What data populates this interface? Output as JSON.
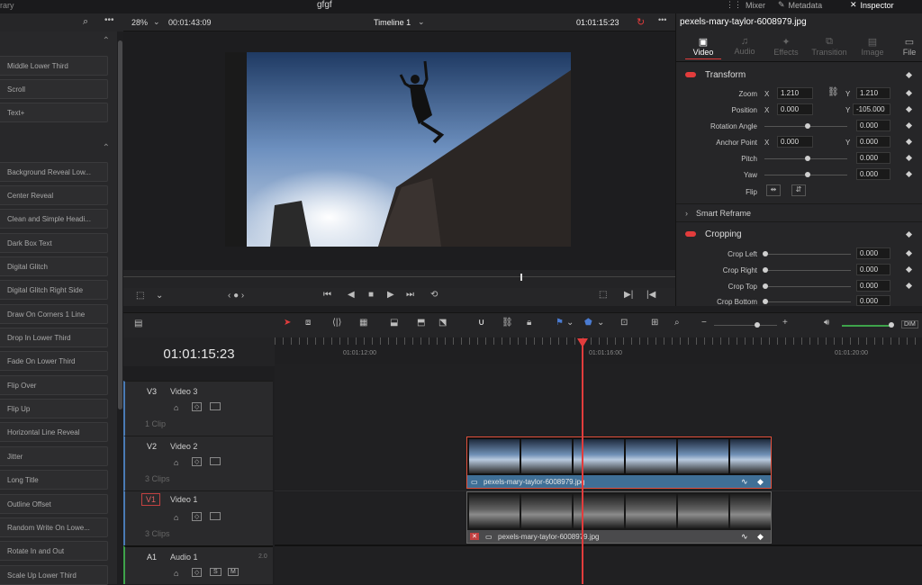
{
  "topbar": {
    "library_label": "rary",
    "project_name": "gfgf",
    "mixer_label": "Mixer",
    "metadata_label": "Metadata",
    "inspector_label": "Inspector"
  },
  "viewer": {
    "zoom": "28%",
    "source_timecode": "00:01:43:09",
    "timeline_name": "Timeline 1",
    "timecode": "01:01:15:23"
  },
  "titles": {
    "items": [
      "Middle Lower Third",
      "Scroll",
      "Text+",
      "Background Reveal Low...",
      "Center Reveal",
      "Clean and Simple Headi...",
      "Dark Box Text",
      "Digital Glitch",
      "Digital Glitch Right Side",
      "Draw On Corners 1 Line",
      "Drop In Lower Third",
      "Fade On Lower Third",
      "Flip Over",
      "Flip Up",
      "Horizontal Line Reveal",
      "Jitter",
      "Long Title",
      "Outline Offset",
      "Random Write On Lowe...",
      "Rotate In and Out",
      "Scale Up Lower Third"
    ]
  },
  "inspector": {
    "clip_name": "pexels-mary-taylor-6008979.jpg",
    "tabs": [
      "Video",
      "Audio",
      "Effects",
      "Transition",
      "Image",
      "File"
    ],
    "transform": {
      "title": "Transform",
      "zoom_label": "Zoom",
      "zoom_x": "1.210",
      "zoom_y": "1.210",
      "position_label": "Position",
      "pos_x": "0.000",
      "pos_y": "-105.000",
      "rotation_label": "Rotation Angle",
      "rotation": "0.000",
      "anchor_label": "Anchor Point",
      "anchor_x": "0.000",
      "anchor_y": "0.000",
      "pitch_label": "Pitch",
      "pitch": "0.000",
      "yaw_label": "Yaw",
      "yaw": "0.000",
      "flip_label": "Flip",
      "x": "X",
      "y": "Y"
    },
    "smart_reframe": "Smart Reframe",
    "cropping": {
      "title": "Cropping",
      "left_label": "Crop Left",
      "left": "0.000",
      "right_label": "Crop Right",
      "right": "0.000",
      "top_label": "Crop Top",
      "top": "0.000",
      "bottom_label": "Crop Bottom",
      "bottom": "0.000"
    }
  },
  "timeline": {
    "timecode": "01:01:15:23",
    "ruler": [
      "01:01:12:00",
      "01:01:16:00",
      "01:01:20:00"
    ],
    "dim_label": "DIM",
    "tracks": [
      {
        "id": "V3",
        "name": "Video 3",
        "clips": "1 Clip"
      },
      {
        "id": "V2",
        "name": "Video 2",
        "clips": "3 Clips"
      },
      {
        "id": "V1",
        "name": "Video 1",
        "clips": "3 Clips"
      },
      {
        "id": "A1",
        "name": "Audio 1",
        "channels": "2.0"
      }
    ],
    "clip_v2": "pexels-mary-taylor-6008979.jpg",
    "clip_v1": "pexels-mary-taylor-6008979.jpg",
    "s_label": "S",
    "m_label": "M"
  },
  "colors": {
    "accent": "#e23c3c",
    "clip_blue": "#3f6f96",
    "audio_green": "#3ea34a"
  }
}
